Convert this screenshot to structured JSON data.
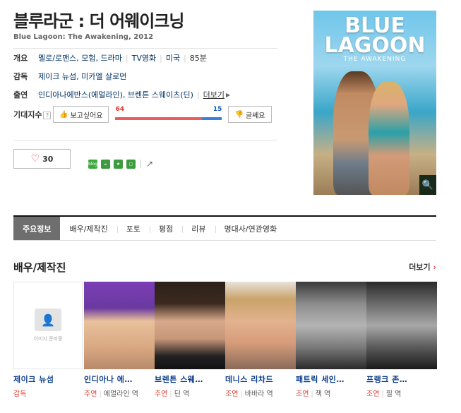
{
  "movie": {
    "title": "블루라군 : 더 어웨이크닝",
    "subtitle": "Blue Lagoon: The Awakening, 2012"
  },
  "info": {
    "overview_label": "개요",
    "genre": "멜로/로맨스, 모험, 드라마",
    "format": "TV영화",
    "country": "미국",
    "runtime": "85분",
    "director_label": "감독",
    "directors": "제이크 뉴섬, 미카엘 살로먼",
    "cast_label": "출연",
    "cast": "인디아나에반스(에멀라인), 브렌튼 스웨이츠(딘)",
    "more": "더보기"
  },
  "expect": {
    "label": "기대지수",
    "want_label": "보고싶어요",
    "want_count": "64",
    "meh_label": "글쎄요",
    "meh_count": "15",
    "want_ratio": 0.81
  },
  "like": {
    "count": "30"
  },
  "share": {
    "blog_label": "blog"
  },
  "poster": {
    "title_line1": "BLUE",
    "title_line2": "LAGOON",
    "tagline": "THE AWAKENING"
  },
  "tabs": [
    "주요정보",
    "배우/제작진",
    "포토",
    "평점",
    "리뷰",
    "명대사/연관영화"
  ],
  "section": {
    "title": "배우/제작진",
    "more": "더보기"
  },
  "empty_photo_text": "이미지 준비중",
  "people": [
    {
      "name": "제이크 뉴섬",
      "role": "감독",
      "character": "",
      "bg": ""
    },
    {
      "name": "인디아나 에…",
      "role": "주연",
      "character": "에멀라인 역",
      "bg": "#6a3aa0"
    },
    {
      "name": "브렌튼 스웨…",
      "role": "주연",
      "character": "딘 역",
      "bg": "#3b2a20"
    },
    {
      "name": "데니스 리차드",
      "role": "조연",
      "character": "바바라 역",
      "bg": "#c9b6a2"
    },
    {
      "name": "패트릭 세인…",
      "role": "조연",
      "character": "잭 역",
      "bg": "#6c6c6c"
    },
    {
      "name": "프랭크 존…",
      "role": "조연",
      "character": "필 역",
      "bg": "#4b4b4b"
    }
  ]
}
